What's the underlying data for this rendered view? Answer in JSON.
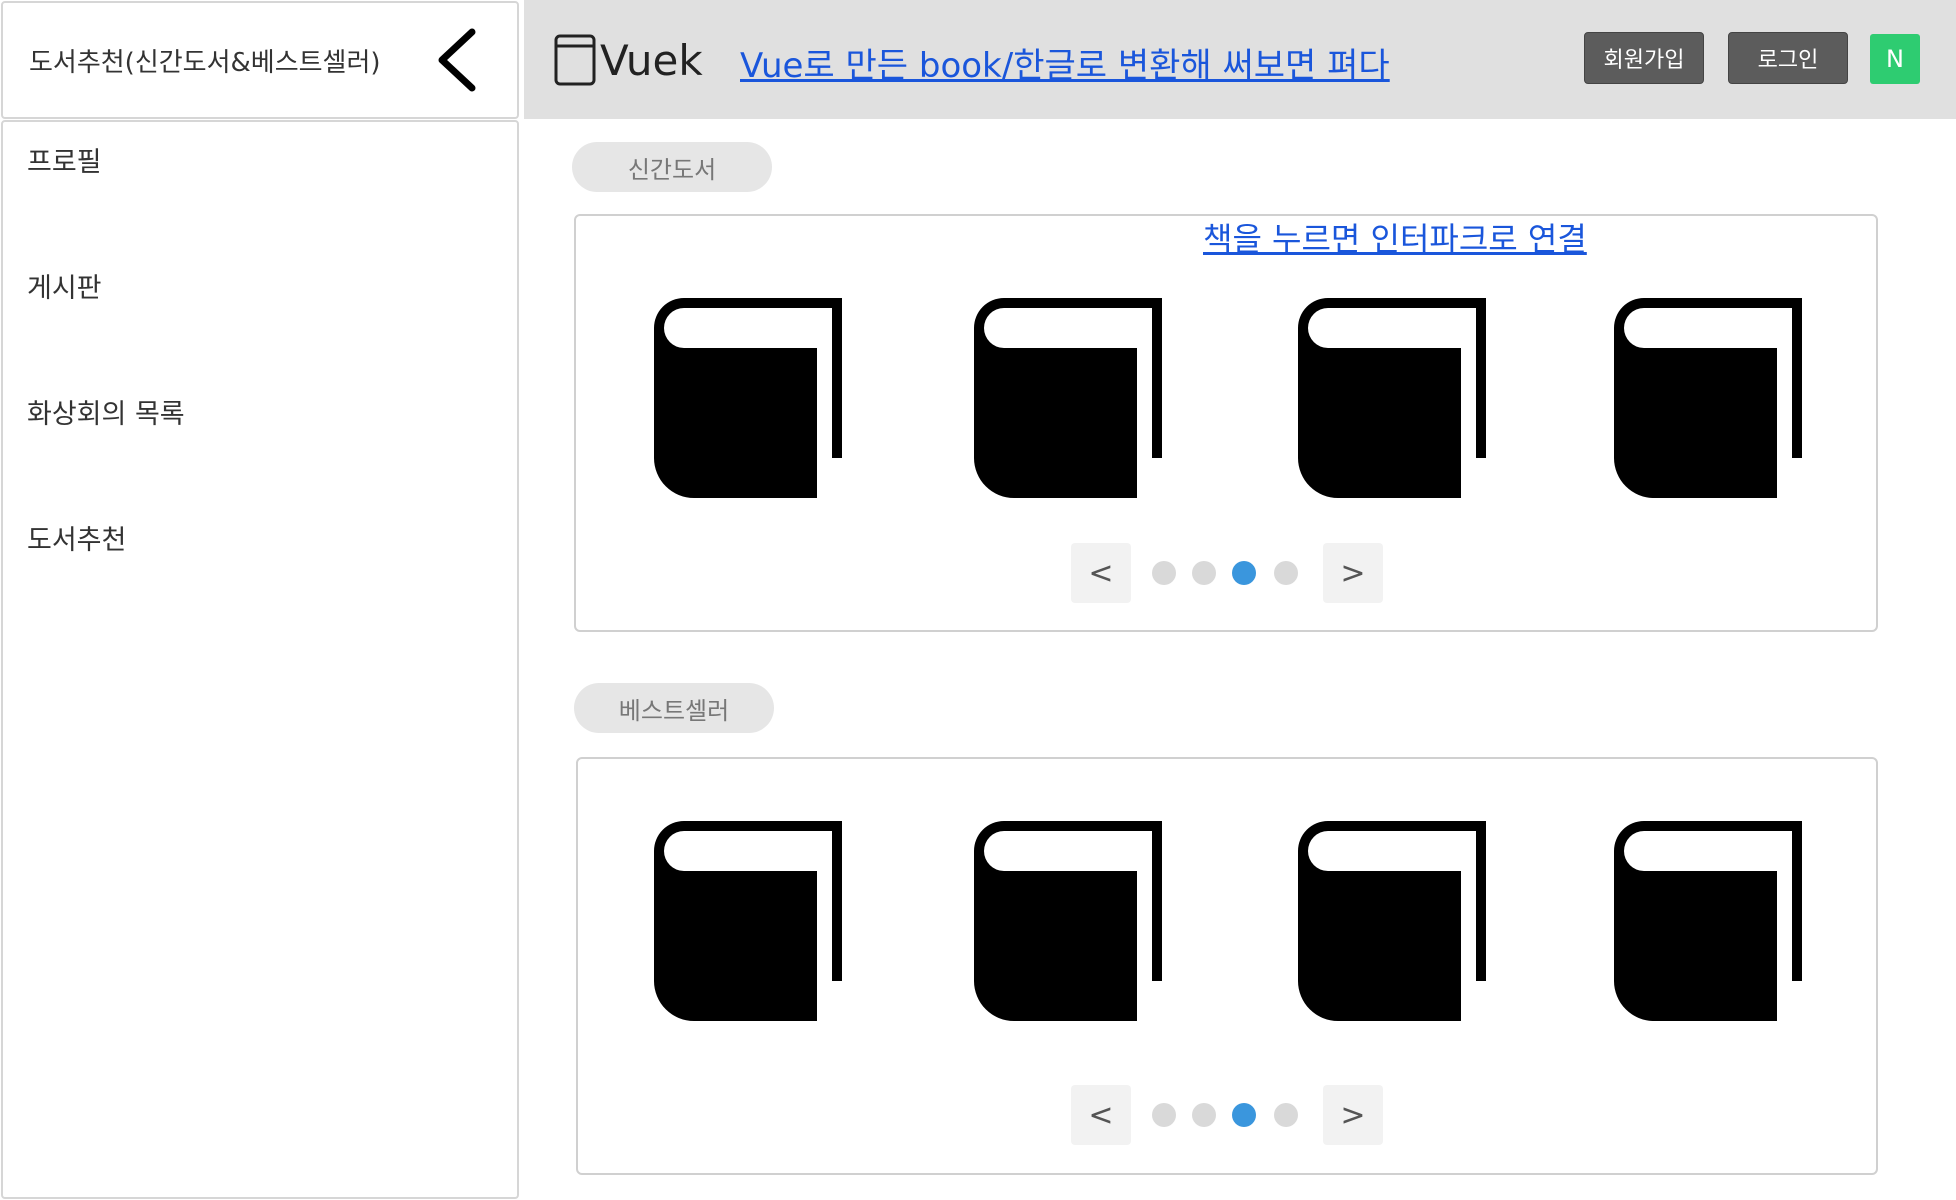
{
  "sidebar": {
    "title": "도서추천(신간도서&베스트셀러)",
    "items": [
      {
        "label": "프로필"
      },
      {
        "label": "게시판"
      },
      {
        "label": "화상회의 목록"
      },
      {
        "label": "도서추천"
      }
    ]
  },
  "header": {
    "logo_text": "Vuek",
    "link_text": "Vue로 만든 book/한글로 변환해 써보면 펴다",
    "signup_label": "회원가입",
    "login_label": "로그인",
    "avatar_initial": "N"
  },
  "sections": {
    "new_books": {
      "label": "신간도서",
      "link_text": "책을 누르면 인터파크로 연결",
      "prev_label": "<",
      "next_label": ">",
      "active_dot": 3,
      "dot_count": 4
    },
    "bestseller": {
      "label": "베스트셀러",
      "prev_label": "<",
      "next_label": ">",
      "active_dot": 3,
      "dot_count": 4
    }
  },
  "colors": {
    "link": "#1a56db",
    "active_dot": "#3a96dd",
    "avatar": "#2ecc71",
    "header_bg": "#e0e0e0"
  }
}
